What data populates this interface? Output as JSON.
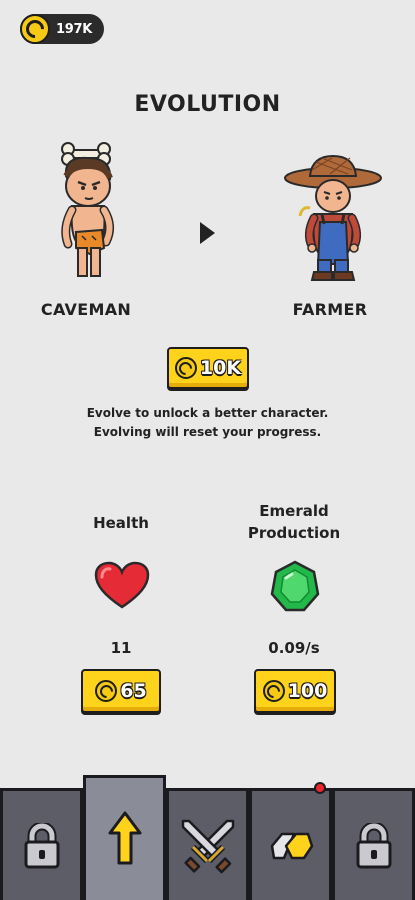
{
  "currency": {
    "amount": "197K",
    "icon": "coin-icon"
  },
  "evolution": {
    "title": "EVOLUTION",
    "from": {
      "name": "CAVEMAN"
    },
    "to": {
      "name": "FARMER"
    },
    "cost": "10K",
    "description_line1": "Evolve to unlock a better character.",
    "description_line2": "Evolving will reset your progress."
  },
  "stats": {
    "health": {
      "label": "Health",
      "value": "11",
      "cost": "65",
      "icon": "heart-icon"
    },
    "emerald": {
      "label_line1": "Emerald",
      "label_line2": "Production",
      "value": "0.09/s",
      "cost": "100",
      "icon": "emerald-icon"
    }
  },
  "nav": {
    "tabs": [
      {
        "icon": "lock-icon",
        "active": false
      },
      {
        "icon": "up-arrow-icon",
        "active": true
      },
      {
        "icon": "crossed-swords-icon",
        "active": false
      },
      {
        "icon": "gems-icon",
        "active": false,
        "notification": true
      },
      {
        "icon": "lock-icon",
        "active": false
      }
    ]
  },
  "colors": {
    "background": "#e9e9e9",
    "button_yellow": "#ffd21c",
    "nav_bg": "#2d2d33",
    "heart": "#e52b35",
    "emerald": "#22b84a"
  }
}
